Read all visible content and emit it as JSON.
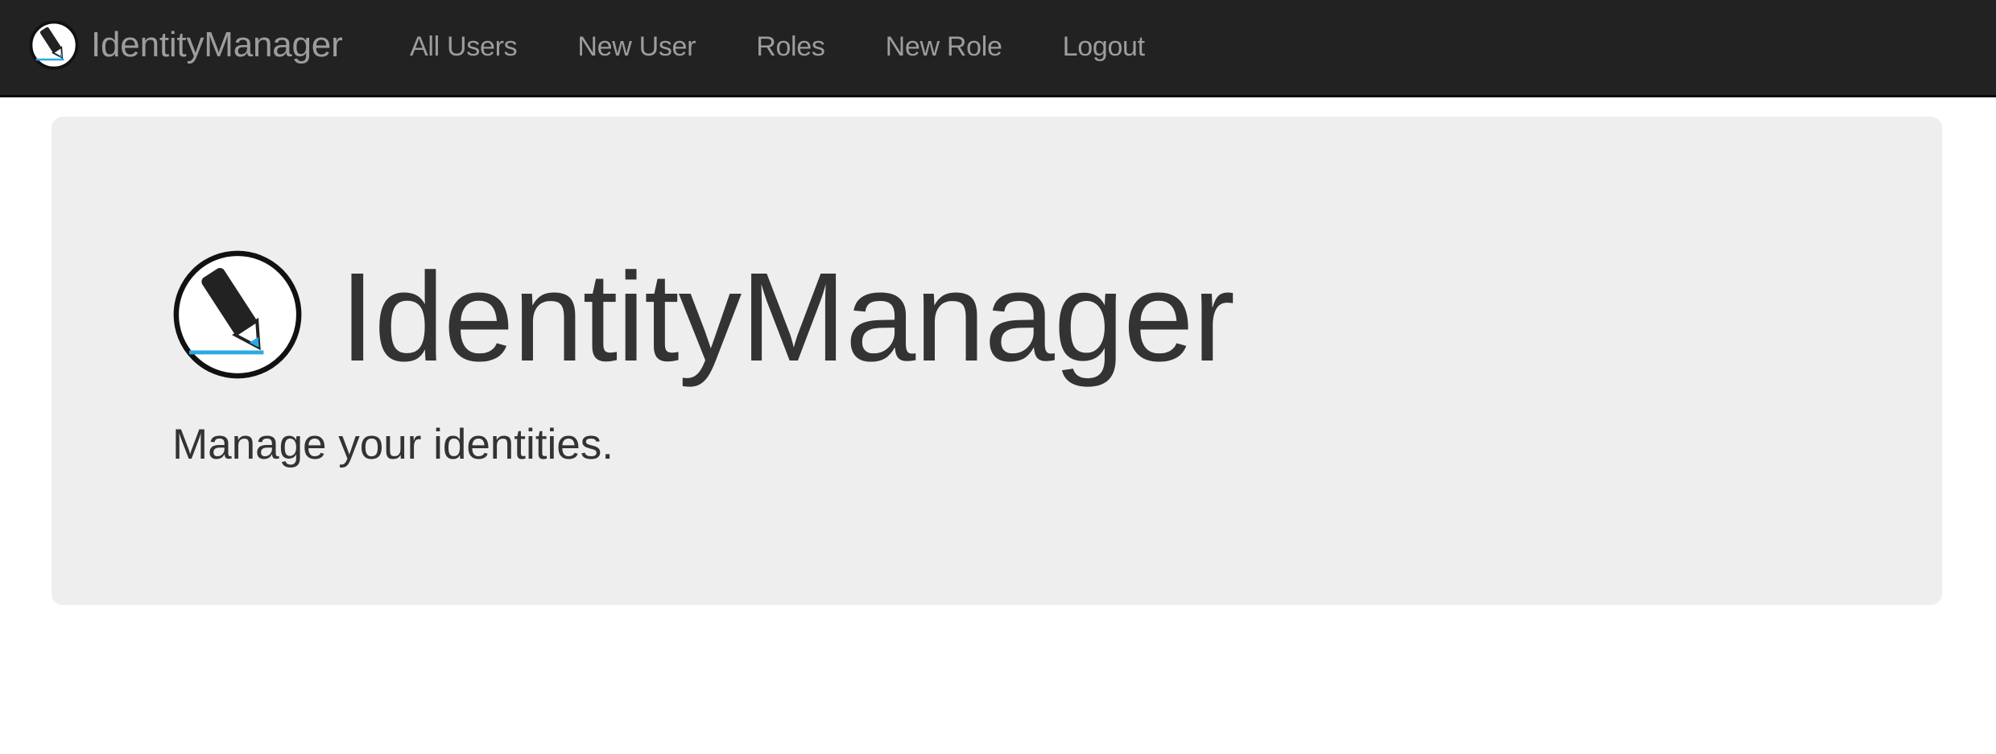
{
  "navbar": {
    "brand": {
      "icon": "pen-circle-logo-icon",
      "label": "IdentityManager"
    },
    "links": [
      {
        "label": "All Users"
      },
      {
        "label": "New User"
      },
      {
        "label": "Roles"
      },
      {
        "label": "New Role"
      },
      {
        "label": "Logout"
      }
    ]
  },
  "hero": {
    "icon": "pen-circle-logo-icon",
    "title": "IdentityManager",
    "subtitle": "Manage your identities."
  },
  "colors": {
    "navbar_bg": "#222222",
    "nav_text": "#9d9d9d",
    "jumbotron_bg": "#eeeeee",
    "text": "#333333",
    "logo_accent": "#29abe2"
  }
}
